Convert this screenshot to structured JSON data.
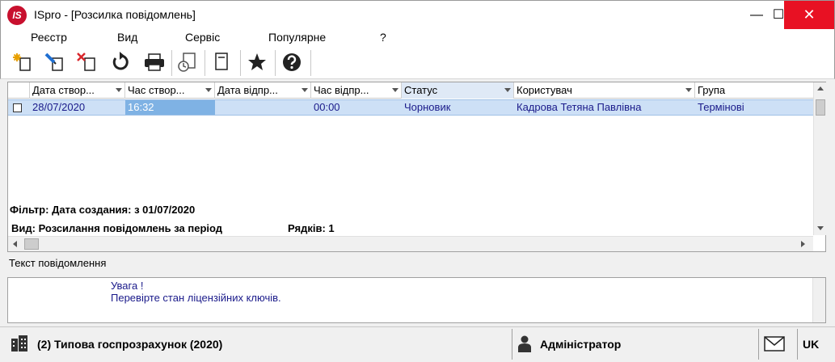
{
  "window": {
    "logo": "IS",
    "title": "ISpro - [Розсилка повідомлень]",
    "minimize": "—",
    "maximize": "☐",
    "close": "✕"
  },
  "menu": [
    "Реєстр",
    "Вид",
    "Сервіс",
    "Популярне",
    "?"
  ],
  "toolbar": {
    "icons": [
      "new-document-icon",
      "edit-document-icon",
      "delete-document-icon",
      "refresh-icon",
      "print-icon",
      "schedule-document-icon",
      "notebook-icon",
      "favorite-star-icon",
      "help-icon"
    ]
  },
  "grid": {
    "columns": [
      "Дата створ...",
      "Час створ...",
      "Дата відпр...",
      "Час відпр...",
      "Статус",
      "Користувач",
      "Група"
    ],
    "rows": [
      {
        "date_created": "28/07/2020",
        "time_created": "16:32",
        "date_sent": "",
        "time_sent": "00:00",
        "status": "Чорновик",
        "user": "Кадрова Тетяна Павлівна",
        "group": "Термінові"
      }
    ],
    "filter": "Фільтр: Дата создания: з 01/07/2020",
    "view": "Вид: Розсилання повідомлень за період",
    "rows_count": "Рядків: 1"
  },
  "message": {
    "label": "Текст повідомлення",
    "lines": [
      "Увага !",
      "Перевірте стан ліцензійних ключів."
    ]
  },
  "statusbar": {
    "company": "(2) Типова госпрозрахунок (2020)",
    "user": "Адміністратор",
    "lang": "UK"
  },
  "colors": {
    "selected_row": "#cde0f6",
    "active_cell": "#7fb2e4",
    "close_button": "#e81123",
    "logo": "#c8102e",
    "row_text": "#1a1a8a"
  }
}
